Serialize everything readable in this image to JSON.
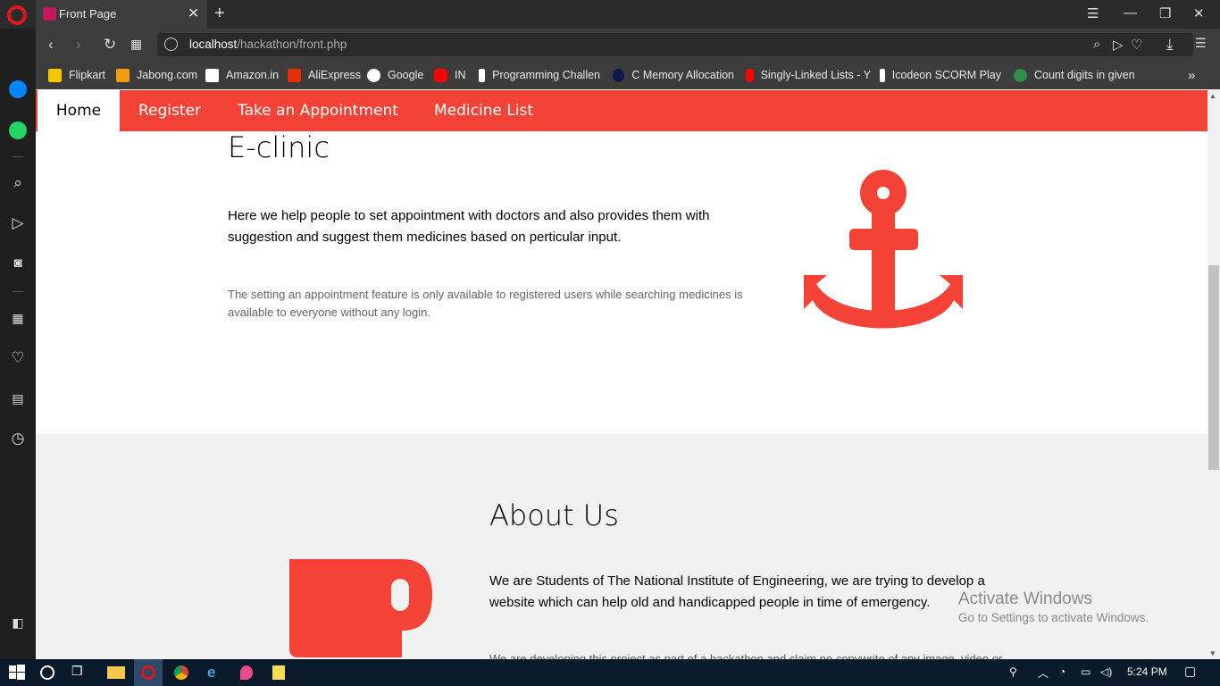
{
  "browser": {
    "tab": {
      "title": "Front Page"
    },
    "url": {
      "host": "localhost",
      "path": "/hackathon/front.php"
    },
    "bookmarks": [
      {
        "label": "Flipkart",
        "icon": "flipkart-icon",
        "color": "#f7c600"
      },
      {
        "label": "Jabong.com",
        "icon": "jabong-icon",
        "color": "#f39c12"
      },
      {
        "label": "Amazon.in",
        "icon": "amazon-icon",
        "color": "#ffffff"
      },
      {
        "label": "AliExpress",
        "icon": "aliexpress-icon",
        "color": "#e62e04"
      },
      {
        "label": "Google",
        "icon": "google-icon",
        "color": "#ffffff"
      },
      {
        "label": "IN",
        "icon": "youtube-icon",
        "color": "#ff0000"
      },
      {
        "label": "Programming Challen",
        "icon": "hackerrank-icon",
        "color": "#ffffff"
      },
      {
        "label": "C Memory Allocation",
        "icon": "c-icon",
        "color": "#0d1a4a"
      },
      {
        "label": "Singly-Linked Lists - Y",
        "icon": "youtube-icon",
        "color": "#ff0000"
      },
      {
        "label": "Icodeon SCORM Play",
        "icon": "icodeon-icon",
        "color": "#ffffff"
      },
      {
        "label": "Count digits in given",
        "icon": "geeksforgeeks-icon",
        "color": "#2f8d46"
      }
    ]
  },
  "page": {
    "nav": [
      "Home",
      "Register",
      "Take an Appointment",
      "Medicine List"
    ],
    "hero": {
      "title": "E-clinic",
      "text": "Here we help people to set appointment with doctors and also provides them with suggestion and suggest them medicines based on perticular input.",
      "subtext": "The setting an appointment feature is only available to registered users while searching medicines is available to everyone without any login."
    },
    "about": {
      "title": "About Us",
      "text": "We are Students of The National Institute of Engineering, we are trying to develop a website which can help old and handicapped people in time of emergency.",
      "subtext": "We are developing this project as part of a hackathon and claim no copywrite of any image, video or"
    },
    "accent_color": "#f44336"
  },
  "watermark": {
    "title": "Activate Windows",
    "subtitle": "Go to Settings to activate Windows."
  },
  "taskbar": {
    "time": "5:24 PM"
  }
}
